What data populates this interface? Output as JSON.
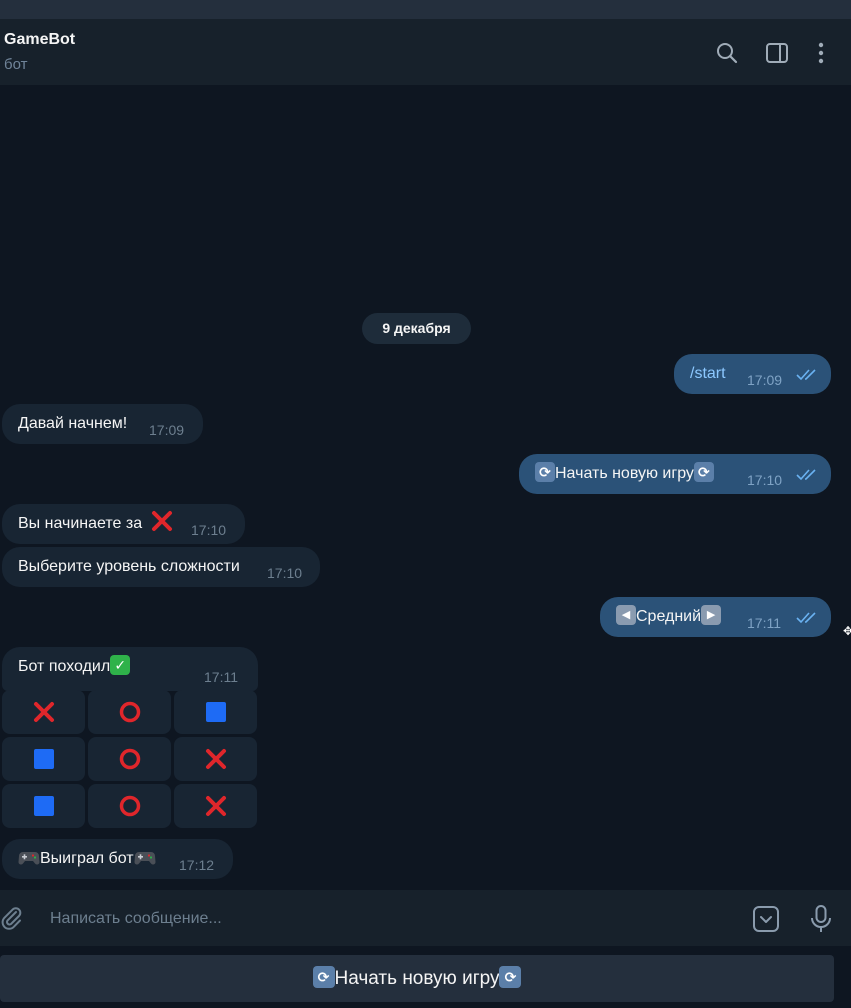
{
  "header": {
    "title": "GameBot",
    "subtitle": "бот"
  },
  "chat": {
    "date": "9 декабря",
    "messages": {
      "m1": {
        "text": "/start",
        "time": "17:09"
      },
      "m2": {
        "text": "Давай начнем!",
        "time": "17:09"
      },
      "m3": {
        "text": "Начать новую игру",
        "time": "17:10"
      },
      "m4": {
        "text": "Вы начинаете за",
        "time": "17:10"
      },
      "m5": {
        "text": "Выберите уровень сложности",
        "time": "17:10"
      },
      "m6": {
        "text": "Средний",
        "time": "17:11"
      },
      "m7": {
        "text": "Бот походил",
        "time": "17:11"
      },
      "m8": {
        "text": "Выиграл бот",
        "time": "17:12"
      }
    },
    "board": [
      [
        "cross-icon",
        "circle-icon",
        "blue-square-icon"
      ],
      [
        "blue-square-icon",
        "circle-icon",
        "cross-icon"
      ],
      [
        "blue-square-icon",
        "circle-icon",
        "cross-icon"
      ]
    ]
  },
  "composer": {
    "placeholder": "Написать сообщение..."
  },
  "keyboard": {
    "button_label": "Начать новую игру"
  },
  "colors": {
    "background": "#0e1621",
    "incoming_bubble": "#182533",
    "outgoing_bubble": "#2b5278",
    "cross": "#e0262b",
    "circle": "#e0262b",
    "blue_square": "#1e6bf5"
  }
}
